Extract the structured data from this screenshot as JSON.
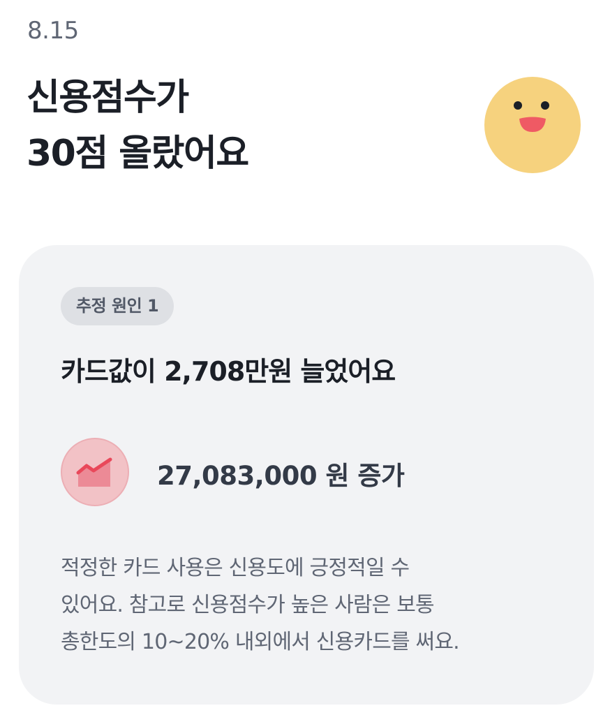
{
  "header": {
    "date": "8.15",
    "title_line1": "신용점수가",
    "title_line2": "30점 올랐어요",
    "face_icon": "smiling-face-icon"
  },
  "card": {
    "badge_label": "추정 원인 1",
    "reason_title": "카드값이 2,708만원 늘었어요",
    "change_icon": "chart-increase-icon",
    "change_amount": "27,083,000 원 증가",
    "description_lines": [
      "적정한 카드 사용은 신용도에 긍정적일 수",
      "있어요. 참고로 신용점수가 높은 사람은 보통",
      "총한도의 10~20% 내외에서 신용카드를 써요."
    ]
  },
  "colors": {
    "face": "#f6d27e",
    "mouth": "#ef5a64",
    "card_background": "#f2f3f5",
    "badge_background": "#dee0e4",
    "chart_circle": "#f2c2c6",
    "chart_line": "#e9485a"
  }
}
